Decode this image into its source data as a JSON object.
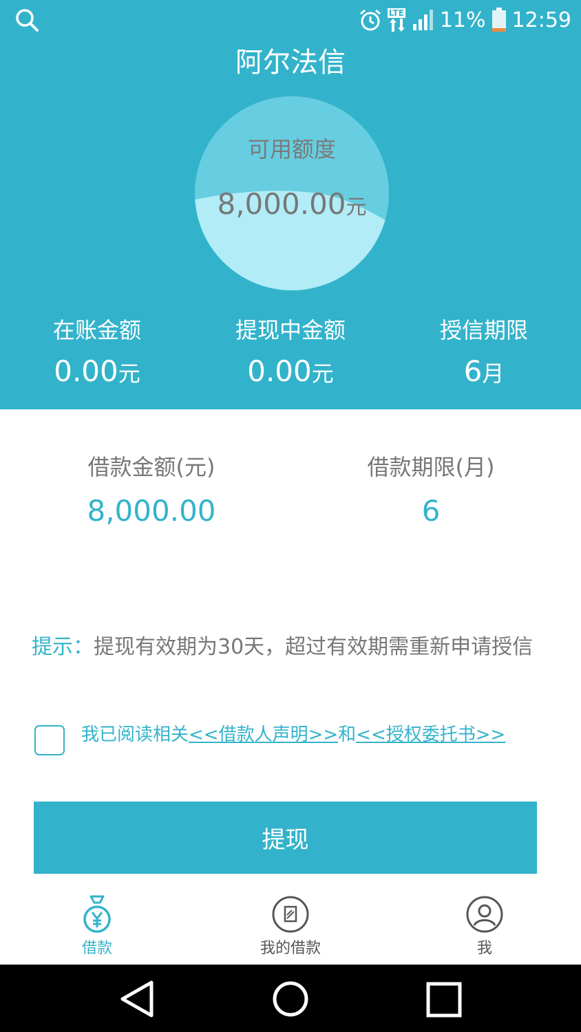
{
  "status_bar": {
    "network": "LTE",
    "battery": "11%",
    "time": "12:59"
  },
  "app": {
    "title": "阿尔法信"
  },
  "credit": {
    "label": "可用额度",
    "amount": "8,000.00",
    "unit": "元"
  },
  "stats": [
    {
      "label": "在账金额",
      "value": "0.00",
      "unit": "元"
    },
    {
      "label": "提现中金额",
      "value": "0.00",
      "unit": "元"
    },
    {
      "label": "授信期限",
      "value": "6",
      "unit": "月"
    }
  ],
  "loan": {
    "amount_label": "借款金额(元)",
    "amount_value": "8,000.00",
    "term_label": "借款期限(月)",
    "term_value": "6"
  },
  "tip": {
    "label": "提示：",
    "text": "提现有效期为30天，超过有效期需重新申请授信"
  },
  "agreement": {
    "checked": false,
    "prefix": "我已阅读相关",
    "link1": "<<借款人声明>>",
    "middle": "和",
    "link2": "<<授权委托书>>"
  },
  "withdraw_button": "提现",
  "tabs": [
    {
      "label": "借款",
      "icon": "money-bag-icon"
    },
    {
      "label": "我的借款",
      "icon": "document-icon"
    },
    {
      "label": "我",
      "icon": "user-icon"
    }
  ],
  "colors": {
    "primary": "#33b3cb",
    "circle": "#67cde0",
    "wave": "#b1ecf7",
    "text_gray": "#777777",
    "tab_inactive": "#555555"
  }
}
